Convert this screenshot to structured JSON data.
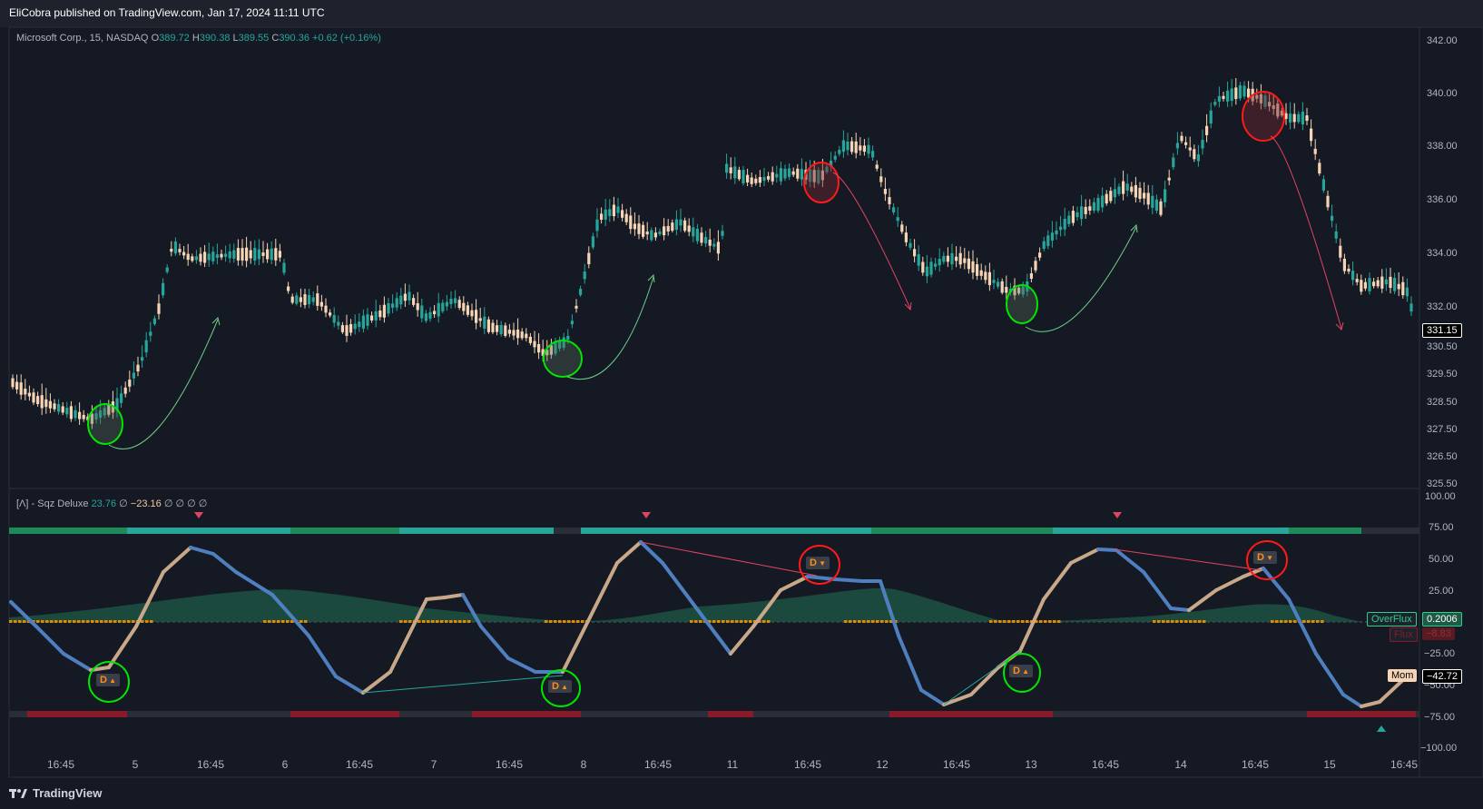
{
  "header": {
    "published_line": "EliCobra published on TradingView.com, Jan 17, 2024 11:11 UTC"
  },
  "symbol_legend": {
    "name": "Microsoft Corp., 15, NASDAQ",
    "o_label": "O",
    "o_value": "389.72",
    "h_label": "H",
    "h_value": "390.38",
    "l_label": "L",
    "l_value": "389.55",
    "c_label": "C",
    "c_value": "390.36",
    "change": "+0.62 (+0.16%)"
  },
  "indicator_legend": {
    "name": "[Λ] - Sqz Deluxe",
    "v1": "23.76",
    "s1": "∅",
    "v2": "−23.16",
    "s2": "∅",
    "s3": "∅",
    "s4": "∅",
    "s5": "∅"
  },
  "price_axis": [
    "342.00",
    "340.00",
    "338.00",
    "336.00",
    "334.00",
    "332.00",
    "330.50",
    "329.50",
    "328.50",
    "327.50",
    "326.50",
    "325.50"
  ],
  "last_price": "331.15",
  "osc_axis": [
    "100.00",
    "75.00",
    "50.00",
    "25.00",
    "−25.00",
    "−50.00",
    "−75.00",
    "−100.00"
  ],
  "osc_tags": {
    "overflux_label": "OverFlux",
    "overflux_value": "0.2006",
    "flux_label": "Flux",
    "flux_value": "−8.83",
    "mom_label": "Mom",
    "mom_value": "−42.72"
  },
  "time_axis": [
    "16:45",
    "5",
    "16:45",
    "6",
    "16:45",
    "7",
    "16:45",
    "8",
    "16:45",
    "11",
    "16:45",
    "12",
    "16:45",
    "13",
    "16:45",
    "14",
    "16:45",
    "15",
    "16:45"
  ],
  "divergence_label": "D",
  "footer": {
    "brand": "TradingView"
  },
  "colors": {
    "background": "#151924",
    "bull_candle": "#26a69a",
    "bear_candle": "#f5d5b5",
    "green_circle": "#00e600",
    "red_circle": "#ff1a1a",
    "mom_rising": "#c8a888",
    "mom_falling": "#4f7fbf",
    "flux_area": "#1e5a46",
    "squeeze_on": "#e08a00",
    "bar_green": "#1e8a5a",
    "bar_red": "#8a1a2a"
  }
}
